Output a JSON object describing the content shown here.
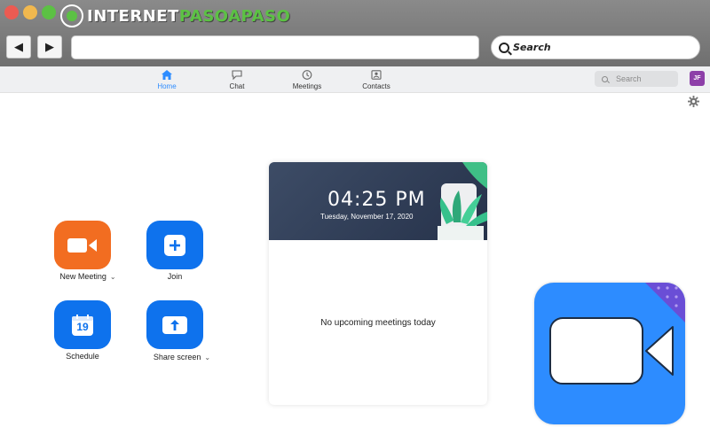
{
  "window": {
    "logo_prefix": "INTERNET",
    "logo_accent": "PASOAPASO"
  },
  "browser": {
    "back_icon": "◀",
    "forward_icon": "▶",
    "search_placeholder": "Search"
  },
  "app": {
    "tabs": [
      {
        "label": "Home",
        "active": true
      },
      {
        "label": "Chat",
        "active": false
      },
      {
        "label": "Meetings",
        "active": false
      },
      {
        "label": "Contacts",
        "active": false
      }
    ],
    "search_placeholder": "Search",
    "avatar_initials": "JF"
  },
  "actions": {
    "new_meeting": "New Meeting",
    "join": "Join",
    "schedule": "Schedule",
    "schedule_day": "19",
    "share_screen": "Share screen"
  },
  "meeting_card": {
    "time": "04:25 PM",
    "date": "Tuesday, November 17, 2020",
    "empty_text": "No upcoming meetings today"
  },
  "colors": {
    "accent": "#2d8cff",
    "orange_tile": "#f26d21",
    "blue_tile": "#0e72ed",
    "avatar": "#8d3fa8"
  }
}
